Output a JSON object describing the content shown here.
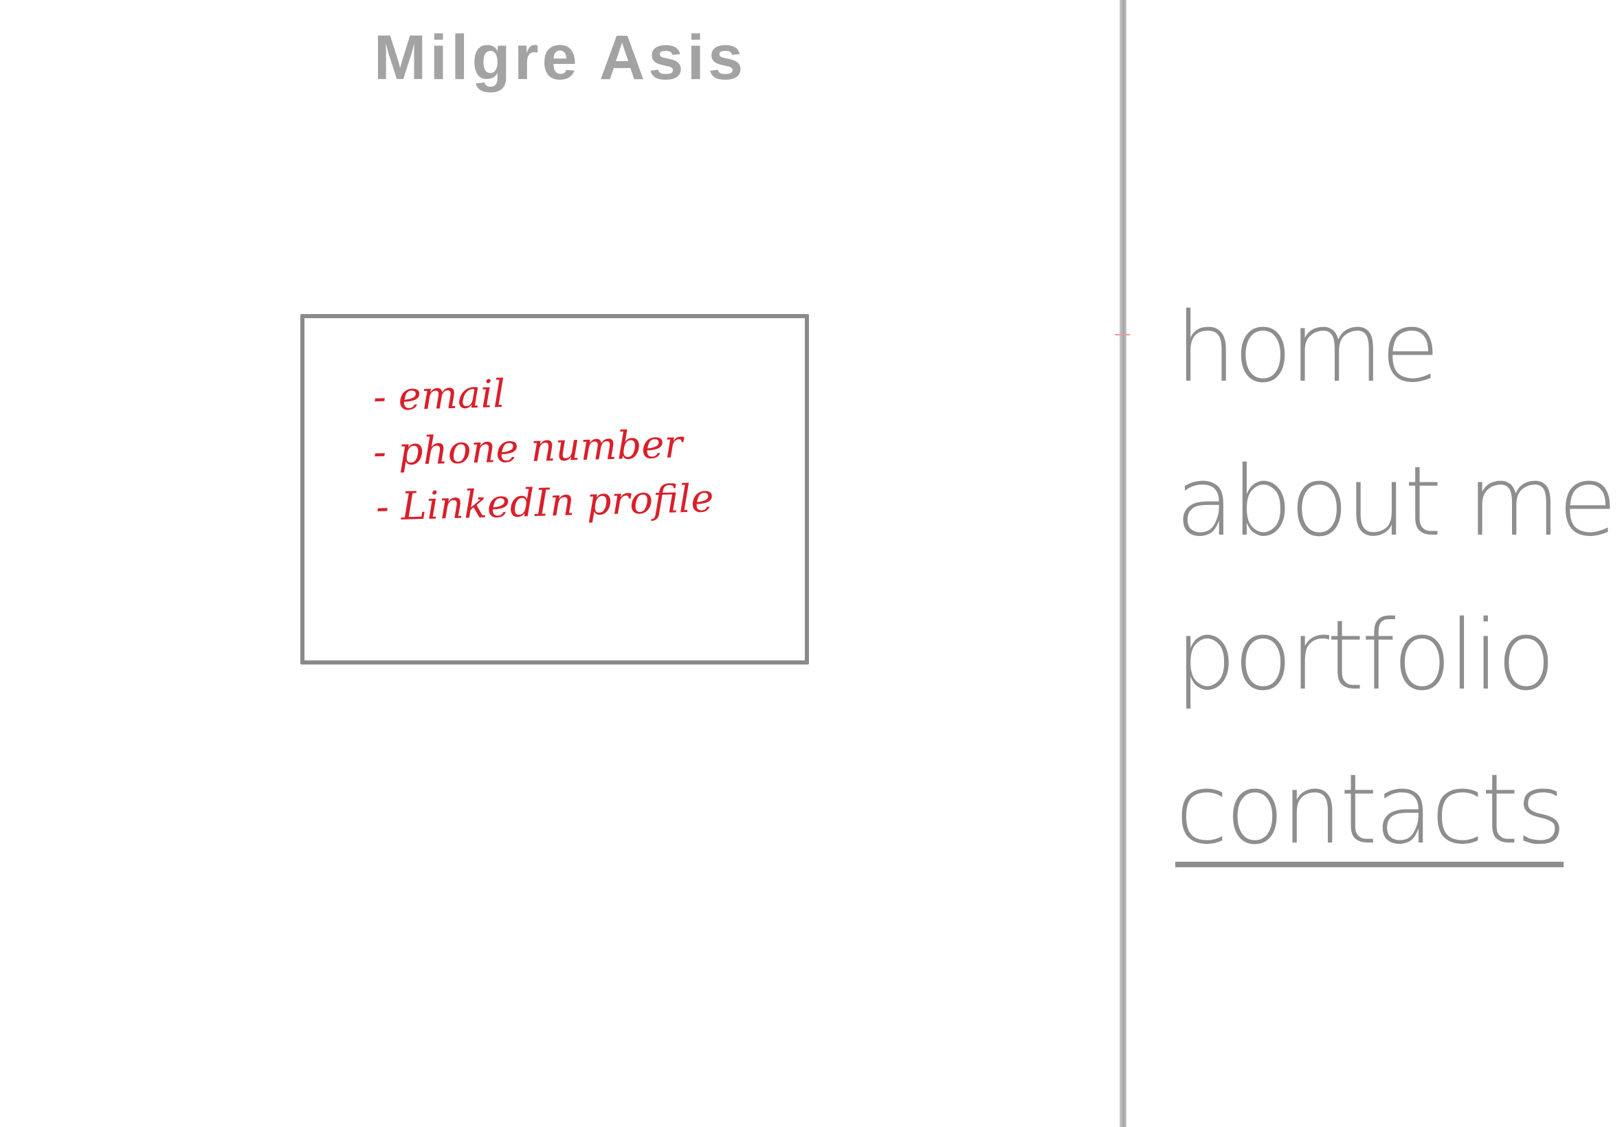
{
  "site": {
    "title": "Milgre Asis"
  },
  "contact_box": {
    "items": [
      "- email",
      "- phone number",
      "- LinkedIn profile"
    ]
  },
  "nav": {
    "items": [
      {
        "label": "home",
        "active": false
      },
      {
        "label": "about me",
        "active": false
      },
      {
        "label": "portfolio",
        "active": false
      },
      {
        "label": "contacts",
        "active": true
      }
    ]
  },
  "colors": {
    "title": "#a3a3a3",
    "annotation": "#d8202a",
    "wireframe": "#8a8a8a",
    "nav": "#8e8e8e"
  }
}
